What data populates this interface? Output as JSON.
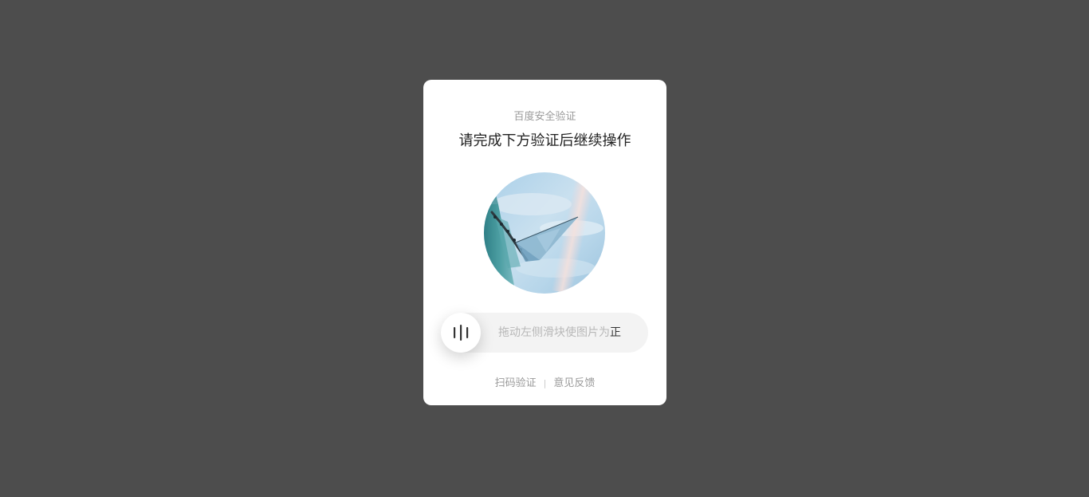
{
  "dialog": {
    "brand": "百度安全验证",
    "title": "请完成下方验证后继续操作"
  },
  "puzzle": {
    "image_icon": "sailboat-photo"
  },
  "slider": {
    "handle_icon": "grip-bars-icon",
    "hint_light": "拖动左侧滑块使图片为",
    "hint_dark": "正"
  },
  "footer": {
    "scan_link": "扫码验证",
    "separator": "|",
    "feedback_link": "意见反馈"
  },
  "colors": {
    "backdrop": "#4d4d4d",
    "card": "#ffffff",
    "track": "#f3f3f3",
    "muted_text": "#9a9a9a",
    "title_text": "#222222"
  }
}
